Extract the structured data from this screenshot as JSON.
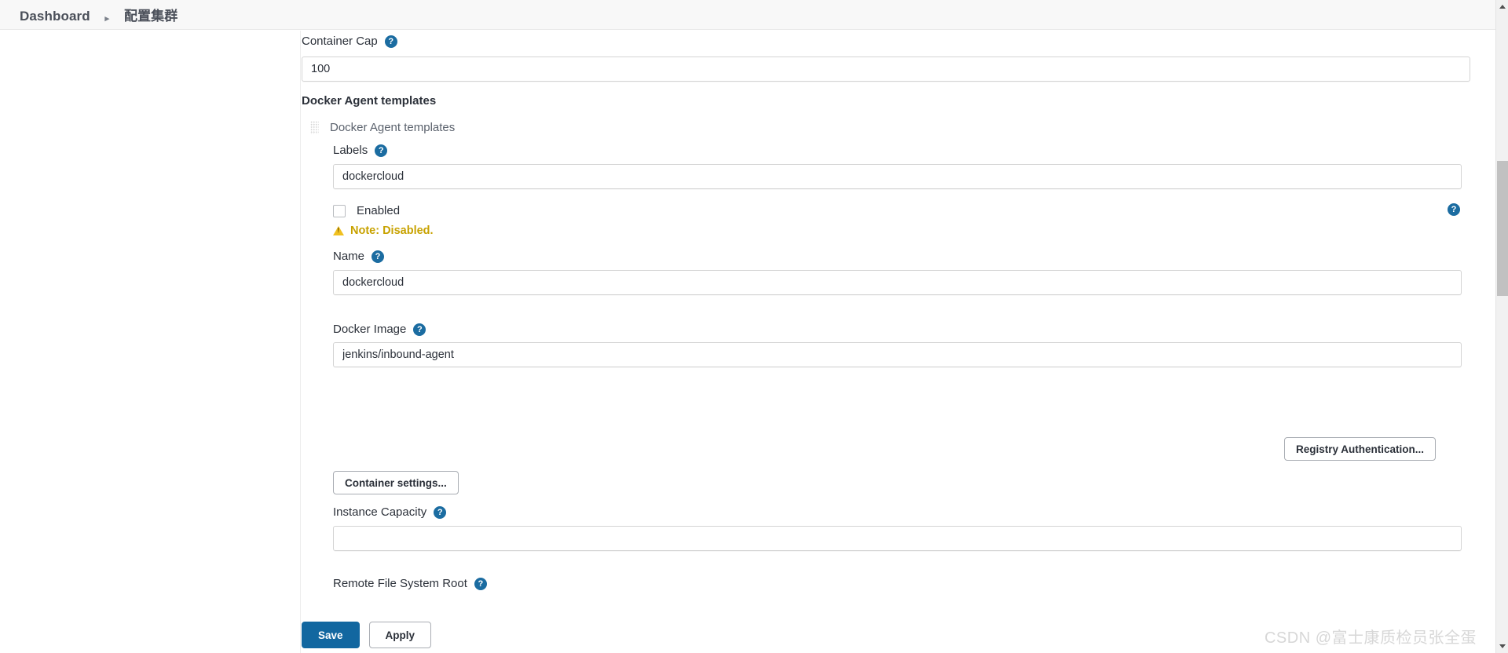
{
  "header": {
    "breadcrumb": {
      "root_label": "Dashboard",
      "separator": "▸",
      "current_label": "配置集群"
    }
  },
  "form": {
    "container_cap": {
      "label": "Container Cap",
      "help_icon": "?",
      "value": "100"
    },
    "docker_agent_templates": {
      "section_heading": "Docker Agent templates",
      "entry_title": "Docker Agent templates",
      "drag_handle_icon": "drag-dots-icon",
      "labels": {
        "label": "Labels",
        "help_icon": "?",
        "value": "dockercloud"
      },
      "enabled": {
        "label": "Enabled",
        "checked": false,
        "help_icon": "?",
        "note_icon": "warning-triangle-icon",
        "note_text": "Note: Disabled."
      },
      "name": {
        "label": "Name",
        "help_icon": "?",
        "value": "dockercloud"
      },
      "docker_image": {
        "label": "Docker Image",
        "help_icon": "?",
        "value": "jenkins/inbound-agent"
      },
      "registry_auth_button": "Registry Authentication...",
      "container_settings_button": "Container settings...",
      "instance_capacity": {
        "label": "Instance Capacity",
        "help_icon": "?",
        "value": ""
      },
      "remote_file_system_root": {
        "label": "Remote File System Root",
        "help_icon": "?"
      }
    }
  },
  "footer": {
    "save_label": "Save",
    "apply_label": "Apply"
  },
  "watermark": {
    "text": "CSDN @富士康质检员张全蛋"
  },
  "scrollbar": {
    "up_arrow_icon": "chevron-up-icon",
    "down_arrow_icon": "chevron-down-icon"
  },
  "colors": {
    "accent": "#1267a0",
    "help_icon": "#1b6ca1",
    "warning": "#c8a200",
    "header_bg": "#f8f8f8"
  }
}
